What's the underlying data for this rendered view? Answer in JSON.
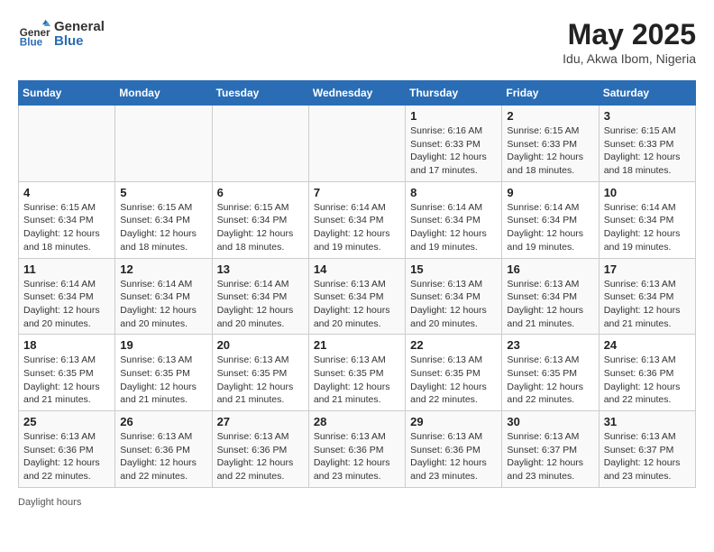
{
  "header": {
    "logo_general": "General",
    "logo_blue": "Blue",
    "month_title": "May 2025",
    "location": "Idu, Akwa Ibom, Nigeria"
  },
  "weekdays": [
    "Sunday",
    "Monday",
    "Tuesday",
    "Wednesday",
    "Thursday",
    "Friday",
    "Saturday"
  ],
  "weeks": [
    [
      {
        "day": "",
        "info": ""
      },
      {
        "day": "",
        "info": ""
      },
      {
        "day": "",
        "info": ""
      },
      {
        "day": "",
        "info": ""
      },
      {
        "day": "1",
        "info": "Sunrise: 6:16 AM\nSunset: 6:33 PM\nDaylight: 12 hours and 17 minutes."
      },
      {
        "day": "2",
        "info": "Sunrise: 6:15 AM\nSunset: 6:33 PM\nDaylight: 12 hours and 18 minutes."
      },
      {
        "day": "3",
        "info": "Sunrise: 6:15 AM\nSunset: 6:33 PM\nDaylight: 12 hours and 18 minutes."
      }
    ],
    [
      {
        "day": "4",
        "info": "Sunrise: 6:15 AM\nSunset: 6:34 PM\nDaylight: 12 hours and 18 minutes."
      },
      {
        "day": "5",
        "info": "Sunrise: 6:15 AM\nSunset: 6:34 PM\nDaylight: 12 hours and 18 minutes."
      },
      {
        "day": "6",
        "info": "Sunrise: 6:15 AM\nSunset: 6:34 PM\nDaylight: 12 hours and 18 minutes."
      },
      {
        "day": "7",
        "info": "Sunrise: 6:14 AM\nSunset: 6:34 PM\nDaylight: 12 hours and 19 minutes."
      },
      {
        "day": "8",
        "info": "Sunrise: 6:14 AM\nSunset: 6:34 PM\nDaylight: 12 hours and 19 minutes."
      },
      {
        "day": "9",
        "info": "Sunrise: 6:14 AM\nSunset: 6:34 PM\nDaylight: 12 hours and 19 minutes."
      },
      {
        "day": "10",
        "info": "Sunrise: 6:14 AM\nSunset: 6:34 PM\nDaylight: 12 hours and 19 minutes."
      }
    ],
    [
      {
        "day": "11",
        "info": "Sunrise: 6:14 AM\nSunset: 6:34 PM\nDaylight: 12 hours and 20 minutes."
      },
      {
        "day": "12",
        "info": "Sunrise: 6:14 AM\nSunset: 6:34 PM\nDaylight: 12 hours and 20 minutes."
      },
      {
        "day": "13",
        "info": "Sunrise: 6:14 AM\nSunset: 6:34 PM\nDaylight: 12 hours and 20 minutes."
      },
      {
        "day": "14",
        "info": "Sunrise: 6:13 AM\nSunset: 6:34 PM\nDaylight: 12 hours and 20 minutes."
      },
      {
        "day": "15",
        "info": "Sunrise: 6:13 AM\nSunset: 6:34 PM\nDaylight: 12 hours and 20 minutes."
      },
      {
        "day": "16",
        "info": "Sunrise: 6:13 AM\nSunset: 6:34 PM\nDaylight: 12 hours and 21 minutes."
      },
      {
        "day": "17",
        "info": "Sunrise: 6:13 AM\nSunset: 6:34 PM\nDaylight: 12 hours and 21 minutes."
      }
    ],
    [
      {
        "day": "18",
        "info": "Sunrise: 6:13 AM\nSunset: 6:35 PM\nDaylight: 12 hours and 21 minutes."
      },
      {
        "day": "19",
        "info": "Sunrise: 6:13 AM\nSunset: 6:35 PM\nDaylight: 12 hours and 21 minutes."
      },
      {
        "day": "20",
        "info": "Sunrise: 6:13 AM\nSunset: 6:35 PM\nDaylight: 12 hours and 21 minutes."
      },
      {
        "day": "21",
        "info": "Sunrise: 6:13 AM\nSunset: 6:35 PM\nDaylight: 12 hours and 21 minutes."
      },
      {
        "day": "22",
        "info": "Sunrise: 6:13 AM\nSunset: 6:35 PM\nDaylight: 12 hours and 22 minutes."
      },
      {
        "day": "23",
        "info": "Sunrise: 6:13 AM\nSunset: 6:35 PM\nDaylight: 12 hours and 22 minutes."
      },
      {
        "day": "24",
        "info": "Sunrise: 6:13 AM\nSunset: 6:36 PM\nDaylight: 12 hours and 22 minutes."
      }
    ],
    [
      {
        "day": "25",
        "info": "Sunrise: 6:13 AM\nSunset: 6:36 PM\nDaylight: 12 hours and 22 minutes."
      },
      {
        "day": "26",
        "info": "Sunrise: 6:13 AM\nSunset: 6:36 PM\nDaylight: 12 hours and 22 minutes."
      },
      {
        "day": "27",
        "info": "Sunrise: 6:13 AM\nSunset: 6:36 PM\nDaylight: 12 hours and 22 minutes."
      },
      {
        "day": "28",
        "info": "Sunrise: 6:13 AM\nSunset: 6:36 PM\nDaylight: 12 hours and 23 minutes."
      },
      {
        "day": "29",
        "info": "Sunrise: 6:13 AM\nSunset: 6:36 PM\nDaylight: 12 hours and 23 minutes."
      },
      {
        "day": "30",
        "info": "Sunrise: 6:13 AM\nSunset: 6:37 PM\nDaylight: 12 hours and 23 minutes."
      },
      {
        "day": "31",
        "info": "Sunrise: 6:13 AM\nSunset: 6:37 PM\nDaylight: 12 hours and 23 minutes."
      }
    ]
  ],
  "footer": "Daylight hours"
}
